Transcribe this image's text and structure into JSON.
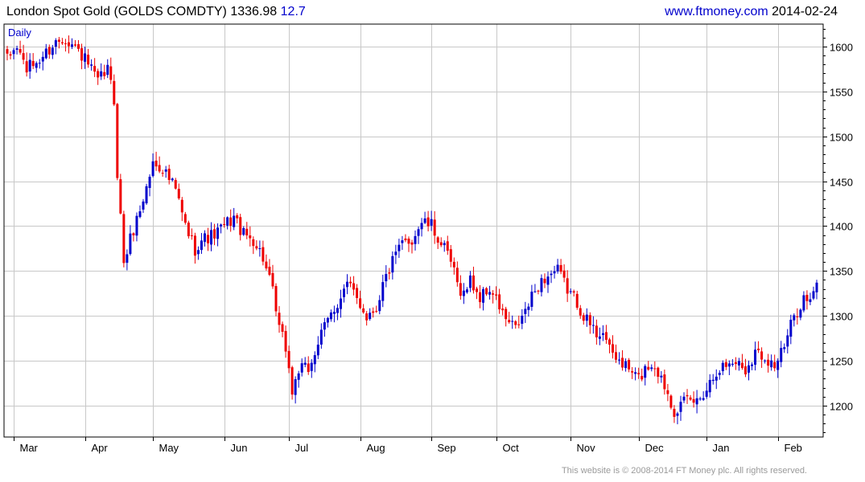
{
  "header": {
    "title": "London Spot Gold (GOLDS COMDTY)",
    "price": "1336.98",
    "change": "12.7",
    "site": "www.ftmoney.com",
    "date": "2014-02-24"
  },
  "footer": {
    "copyright": "This website is © 2008-2014 FT Money plc. All rights reserved."
  },
  "colors": {
    "up": "#0000cc",
    "down": "#ee0000",
    "grid": "#c8c8c8",
    "axis": "#000000"
  },
  "chart_data": {
    "type": "candlestick",
    "period_label": "Daily",
    "ylim": [
      1165,
      1625
    ],
    "y_ticks": [
      1200,
      1250,
      1300,
      1350,
      1400,
      1450,
      1500,
      1550,
      1600
    ],
    "x_ticks": [
      {
        "label": "Mar",
        "x": 2
      },
      {
        "label": "Apr",
        "x": 24
      },
      {
        "label": "May",
        "x": 45
      },
      {
        "label": "Jun",
        "x": 67
      },
      {
        "label": "Jul",
        "x": 87
      },
      {
        "label": "Aug",
        "x": 109
      },
      {
        "label": "Sep",
        "x": 131
      },
      {
        "label": "Oct",
        "x": 151
      },
      {
        "label": "Nov",
        "x": 174
      },
      {
        "label": "Dec",
        "x": 195
      },
      {
        "label": "Jan",
        "x": 216
      },
      {
        "label": "Feb",
        "x": 238
      }
    ],
    "grid": true,
    "anchor_closes": [
      [
        0,
        1585
      ],
      [
        3,
        1600
      ],
      [
        6,
        1575
      ],
      [
        10,
        1585
      ],
      [
        15,
        1605
      ],
      [
        18,
        1610
      ],
      [
        22,
        1595
      ],
      [
        25,
        1580
      ],
      [
        28,
        1560
      ],
      [
        31,
        1575
      ],
      [
        33,
        1540
      ],
      [
        34,
        1460
      ],
      [
        36,
        1360
      ],
      [
        38,
        1385
      ],
      [
        42,
        1430
      ],
      [
        45,
        1470
      ],
      [
        48,
        1465
      ],
      [
        52,
        1440
      ],
      [
        55,
        1400
      ],
      [
        58,
        1375
      ],
      [
        60,
        1385
      ],
      [
        64,
        1390
      ],
      [
        67,
        1400
      ],
      [
        70,
        1410
      ],
      [
        73,
        1390
      ],
      [
        76,
        1385
      ],
      [
        79,
        1365
      ],
      [
        82,
        1325
      ],
      [
        84,
        1285
      ],
      [
        86,
        1265
      ],
      [
        88,
        1215
      ],
      [
        90,
        1240
      ],
      [
        93,
        1240
      ],
      [
        96,
        1270
      ],
      [
        99,
        1295
      ],
      [
        102,
        1315
      ],
      [
        105,
        1335
      ],
      [
        108,
        1320
      ],
      [
        111,
        1300
      ],
      [
        114,
        1310
      ],
      [
        116,
        1335
      ],
      [
        119,
        1360
      ],
      [
        122,
        1380
      ],
      [
        125,
        1385
      ],
      [
        128,
        1405
      ],
      [
        131,
        1400
      ],
      [
        134,
        1380
      ],
      [
        137,
        1360
      ],
      [
        139,
        1335
      ],
      [
        141,
        1325
      ],
      [
        143,
        1340
      ],
      [
        146,
        1320
      ],
      [
        149,
        1330
      ],
      [
        152,
        1310
      ],
      [
        154,
        1295
      ],
      [
        157,
        1285
      ],
      [
        160,
        1305
      ],
      [
        164,
        1335
      ],
      [
        167,
        1345
      ],
      [
        170,
        1350
      ],
      [
        173,
        1330
      ],
      [
        176,
        1315
      ],
      [
        179,
        1295
      ],
      [
        182,
        1280
      ],
      [
        184,
        1285
      ],
      [
        186,
        1260
      ],
      [
        189,
        1250
      ],
      [
        192,
        1240
      ],
      [
        195,
        1230
      ],
      [
        198,
        1245
      ],
      [
        200,
        1245
      ],
      [
        202,
        1230
      ],
      [
        204,
        1215
      ],
      [
        206,
        1195
      ],
      [
        208,
        1200
      ],
      [
        210,
        1205
      ],
      [
        213,
        1205
      ],
      [
        216,
        1220
      ],
      [
        219,
        1240
      ],
      [
        222,
        1245
      ],
      [
        225,
        1250
      ],
      [
        228,
        1240
      ],
      [
        231,
        1260
      ],
      [
        234,
        1255
      ],
      [
        237,
        1245
      ],
      [
        240,
        1265
      ],
      [
        243,
        1300
      ],
      [
        246,
        1320
      ],
      [
        248,
        1315
      ],
      [
        250,
        1330
      ]
    ],
    "last_close": 1336.98,
    "last_change": 12.7
  }
}
